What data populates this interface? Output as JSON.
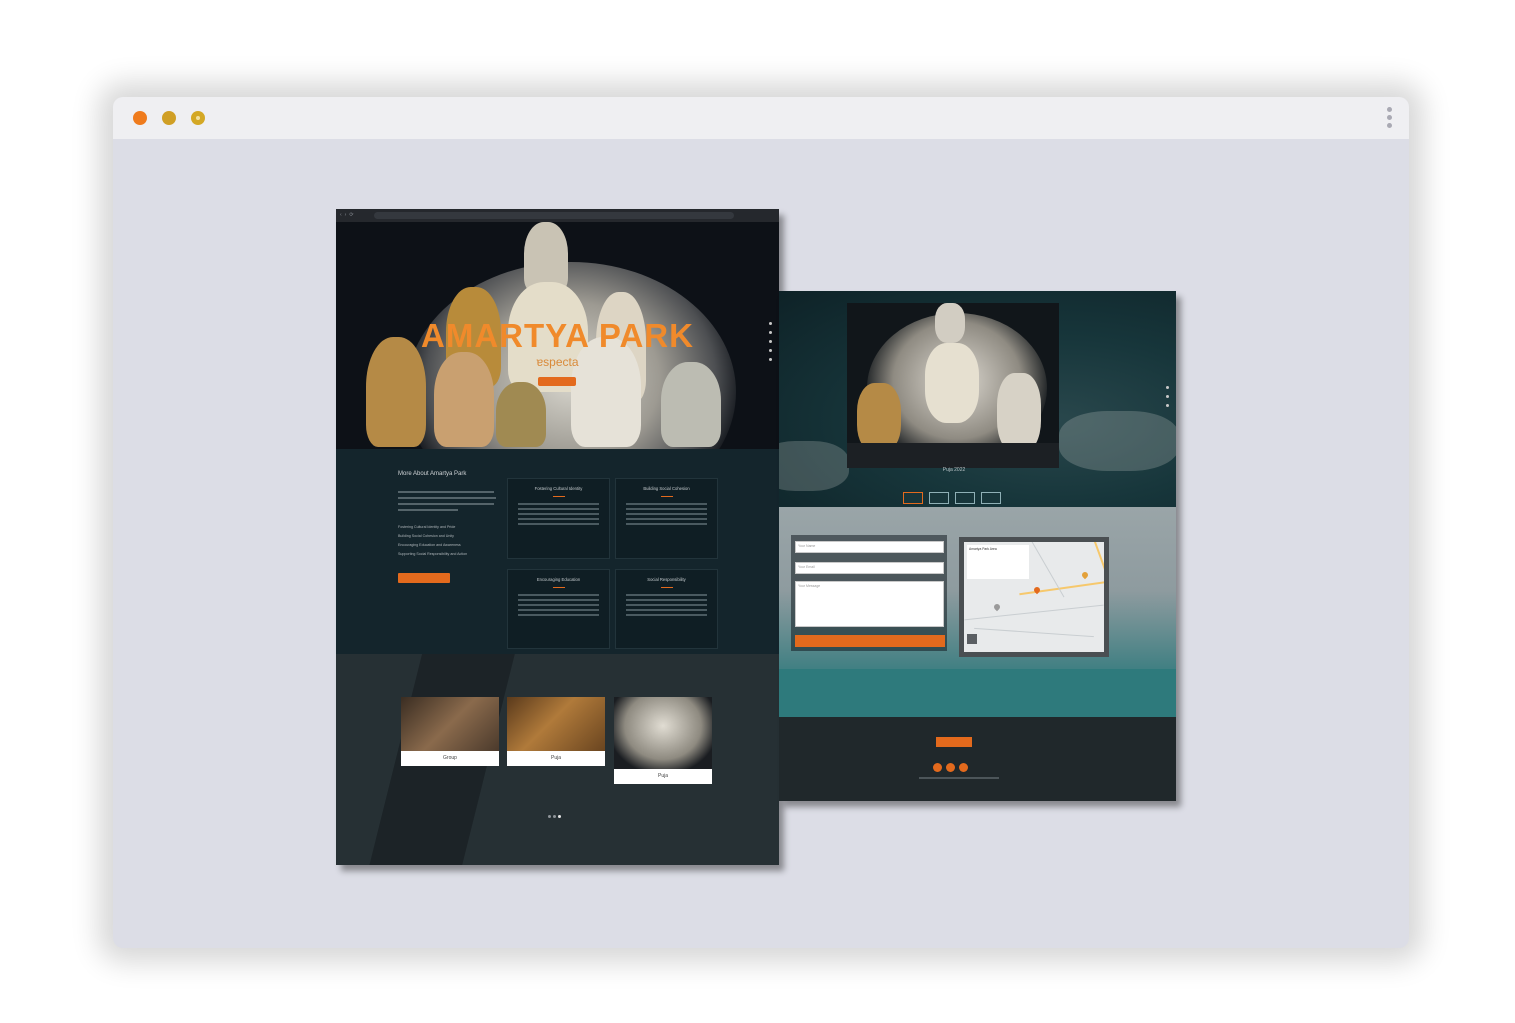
{
  "window": {
    "controls": [
      "close",
      "minimize",
      "maximize"
    ],
    "menu_icon": "kebab-menu-icon"
  },
  "left_mockup": {
    "hero": {
      "title": "AMARTYA PARK",
      "subtitle": "ɐspecta"
    },
    "about": {
      "heading": "More About Amartya Park",
      "bullets": [
        "Fostering Cultural Identity and Pride",
        "Building Social Cohesion and Unity",
        "Encouraging Education and Awareness",
        "Supporting Social Responsibility and Action"
      ],
      "cards": [
        {
          "title": "Fostering Cultural Identity"
        },
        {
          "title": "Building Social Cohesion"
        },
        {
          "title": "Encouraging Education"
        },
        {
          "title": "Social Responsibility"
        }
      ]
    },
    "gallery": {
      "items": [
        {
          "caption": "Group"
        },
        {
          "caption": "Puja"
        },
        {
          "caption": "Puja"
        }
      ],
      "active_dot": 3,
      "dot_count": 3
    }
  },
  "right_mockup": {
    "slider": {
      "caption": "Puja 2022",
      "tab_count": 4,
      "active_tab": 1
    },
    "contact": {
      "fields": [
        "Your Name",
        "Your Email",
        "Your Message"
      ]
    },
    "map": {
      "place": "Amartya Park Area"
    }
  },
  "colors": {
    "accent": "#e36a1d",
    "title_orange": "#f08a2b",
    "dark_bg": "#1f272b",
    "window_bg": "#dcdde6"
  }
}
